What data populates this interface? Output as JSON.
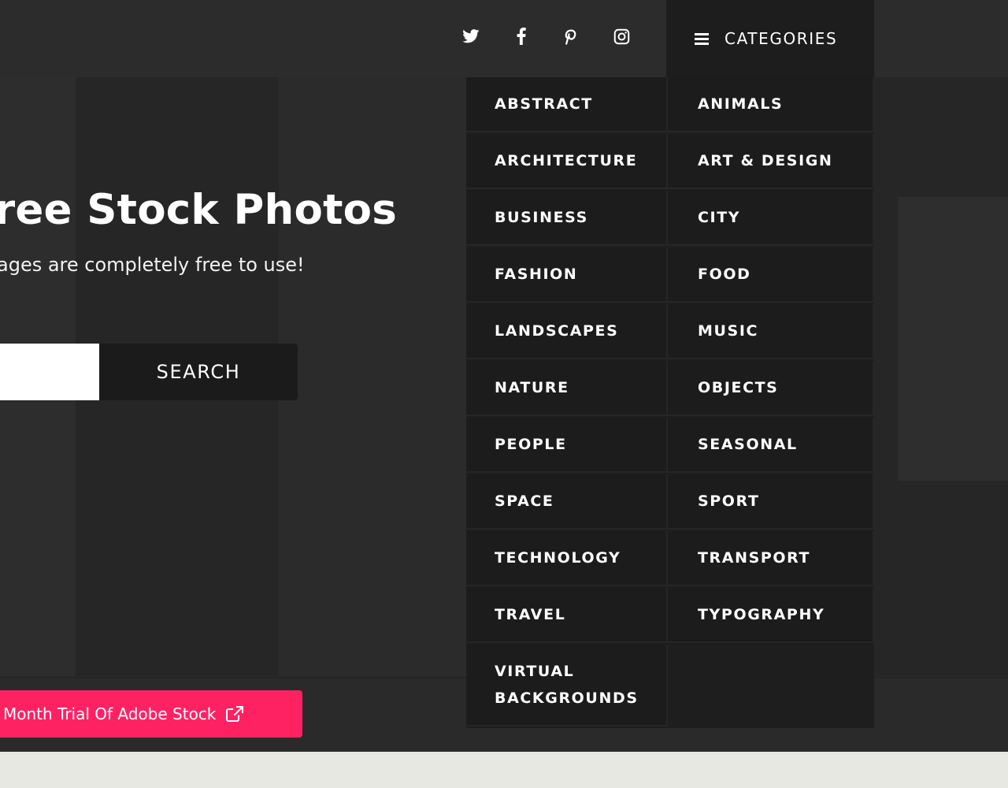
{
  "social": [
    {
      "name": "twitter-icon"
    },
    {
      "name": "facebook-icon"
    },
    {
      "name": "pinterest-icon"
    },
    {
      "name": "instagram-icon"
    }
  ],
  "categories_toggle": {
    "label": "CATEGORIES"
  },
  "categories": {
    "left": [
      "ABSTRACT",
      "ARCHITECTURE",
      "BUSINESS",
      "FASHION",
      "LANDSCAPES",
      "NATURE",
      "PEOPLE",
      "SPACE",
      "TECHNOLOGY",
      "TRAVEL",
      "VIRTUAL BACKGROUNDS"
    ],
    "right": [
      "ANIMALS",
      "ART & DESIGN",
      "CITY",
      "FOOD",
      "MUSIC",
      "OBJECTS",
      "SEASONAL",
      "SPORT",
      "TRANSPORT",
      "TYPOGRAPHY"
    ]
  },
  "hero": {
    "title": "ree Stock Photos",
    "subtitle": "ages are completely free to use!"
  },
  "search": {
    "button_label": "SEARCH",
    "placeholder": ""
  },
  "promo": {
    "label": "Month Trial Of Adobe Stock"
  },
  "colors": {
    "accent": "#ff2263",
    "hero_bg": "#2a2a2a",
    "menu_bg": "#1c1c1c",
    "page_bg": "#e8e8e3"
  }
}
